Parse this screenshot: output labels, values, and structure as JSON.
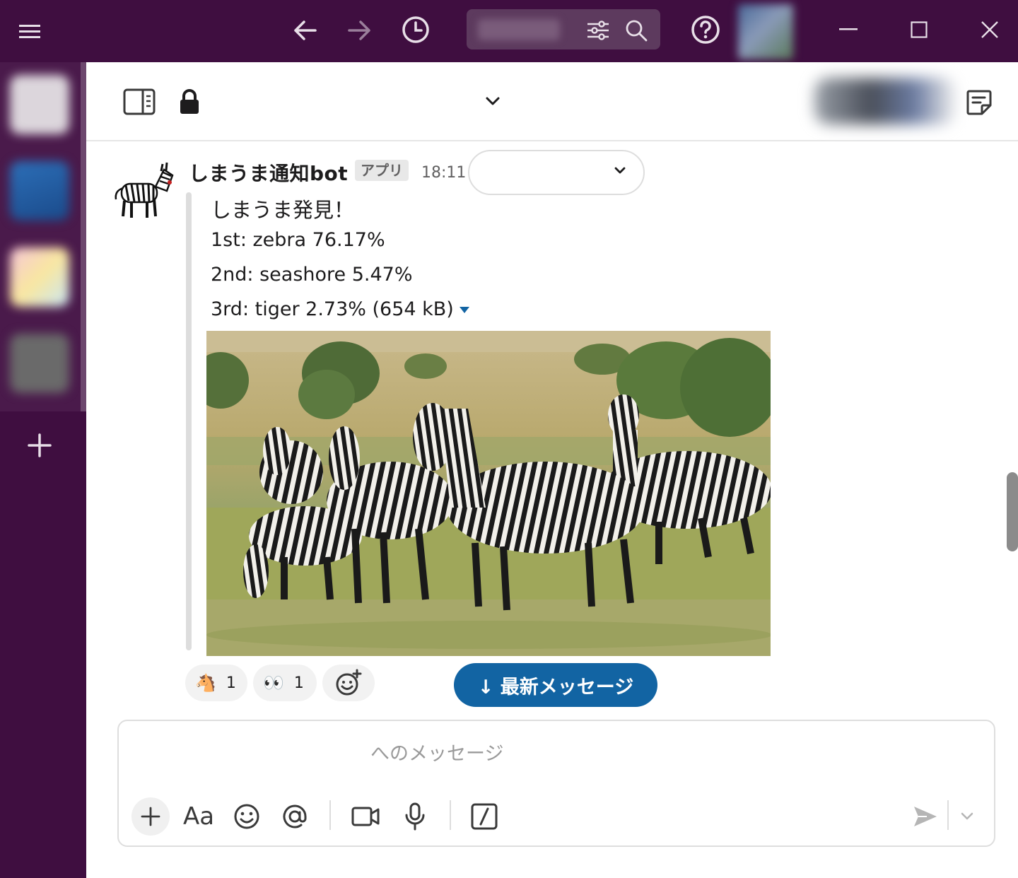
{
  "colors": {
    "aubergine": "#3f0e40",
    "link_blue": "#1264a3",
    "text": "#1d1c1d",
    "muted": "#616061"
  },
  "titlebar": {
    "icons": [
      "menu-icon",
      "back-arrow-icon",
      "forward-arrow-icon",
      "history-clock-icon",
      "filter-sliders-icon",
      "search-icon",
      "help-icon",
      "minimize-icon",
      "maximize-icon",
      "close-icon"
    ]
  },
  "sidebar": {
    "add_label": "+"
  },
  "header": {
    "icons": [
      "sidebar-toggle-icon",
      "lock-icon",
      "chevron-down-icon",
      "canvas-note-icon"
    ]
  },
  "message": {
    "author": "しまうま通知bot",
    "badge": "アプリ",
    "time": "18:11",
    "lines": [
      "しまうま発見！",
      "1st: zebra 76.17%",
      "2nd: seashore 5.47%",
      "3rd: tiger 2.73% (654 kB)"
    ]
  },
  "reactions": [
    {
      "emoji": "🐴",
      "count": "1"
    },
    {
      "emoji": "👀",
      "count": "1"
    }
  ],
  "new_messages_button": "↓ 最新メッセージ",
  "composer": {
    "placeholder": "へのメッセージ",
    "format_label": "Aa",
    "tools": [
      "plus-icon",
      "format-text-icon",
      "emoji-icon",
      "mention-icon",
      "video-icon",
      "microphone-icon",
      "slash-command-icon",
      "send-icon",
      "send-options-chevron-icon"
    ]
  }
}
